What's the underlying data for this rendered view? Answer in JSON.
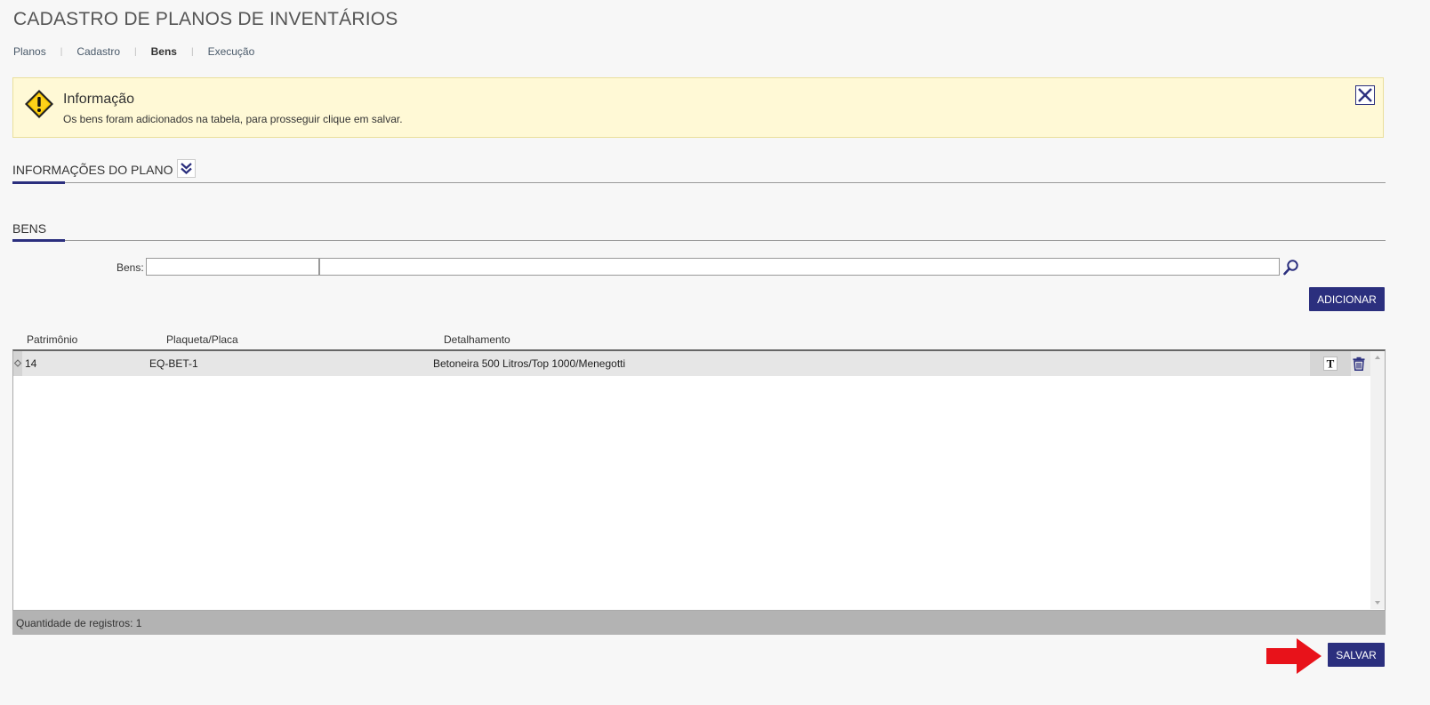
{
  "page": {
    "title": "CADASTRO DE PLANOS DE INVENTÁRIOS"
  },
  "nav": {
    "items": [
      {
        "label": "Planos"
      },
      {
        "label": "Cadastro"
      },
      {
        "label": "Bens",
        "active": true
      },
      {
        "label": "Execução"
      }
    ],
    "separator": "|"
  },
  "alert": {
    "title": "Informação",
    "message": "Os bens foram adicionados na tabela, para prosseguir clique em salvar.",
    "background": "#fff9d6"
  },
  "sections": {
    "plan_info": "INFORMAÇÕES DO PLANO",
    "bens": "BENS"
  },
  "bens_search": {
    "label": "Bens:",
    "code_value": "",
    "description_value": ""
  },
  "buttons": {
    "add": "ADICIONAR",
    "save": "SALVAR"
  },
  "table": {
    "columns": [
      "Patrimônio",
      "Plaqueta/Placa",
      "Detalhamento"
    ],
    "rows": [
      {
        "patrimonio": "14",
        "plaqueta": "EQ-BET-1",
        "detalhamento": "Betoneira 500 Litros/Top 1000/Menegotti"
      }
    ],
    "footer": "Quantidade de registros: 1"
  },
  "colors": {
    "primary": "#2b2f7e",
    "arrow": "#e8121a"
  },
  "icons": {
    "warning": "warning-icon",
    "close": "close-icon",
    "expand": "double-chevron-down-icon",
    "search": "search-icon",
    "text": "text-format-icon",
    "delete": "trash-icon",
    "arrow": "right-arrow-icon"
  }
}
